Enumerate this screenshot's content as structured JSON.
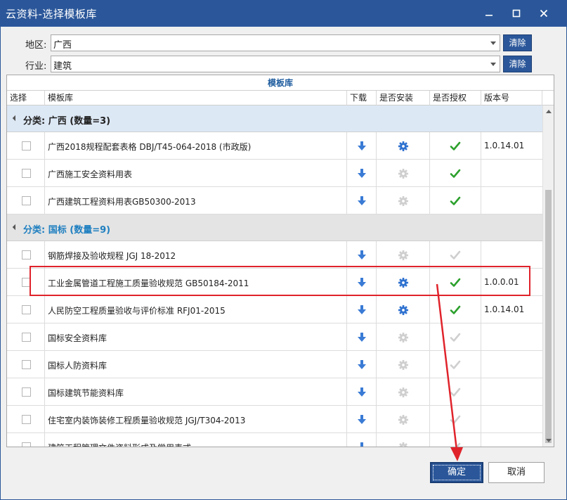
{
  "window": {
    "title": "云资料-选择模板库",
    "controls": [
      "minimize",
      "maximize",
      "close"
    ]
  },
  "filters": {
    "region_label": "地区:",
    "region_value": "广西",
    "industry_label": "行业:",
    "industry_value": "建筑",
    "clear_label": "清除"
  },
  "grid": {
    "caption": "模板库",
    "columns": {
      "select": "选择",
      "name": "模板库",
      "download": "下载",
      "installed": "是否安装",
      "authorized": "是否授权",
      "version": "版本号"
    },
    "groups": [
      {
        "label": "分类: 广西 (数量=3)",
        "rows": [
          {
            "name": "广西2018规程配套表格 DBJ/T45-064-2018 (市政版)",
            "installed": true,
            "authorized": true,
            "version": "1.0.14.01"
          },
          {
            "name": "广西施工安全资料用表",
            "installed": false,
            "authorized": true,
            "version": ""
          },
          {
            "name": "广西建筑工程资料用表GB50300-2013",
            "installed": false,
            "authorized": true,
            "version": ""
          }
        ]
      },
      {
        "label": "分类: 国标 (数量=9)",
        "rows": [
          {
            "name": "钢筋焊接及验收规程 JGJ 18-2012",
            "installed": false,
            "authorized": false,
            "version": ""
          },
          {
            "name": "工业金属管道工程施工质量验收规范 GB50184-2011",
            "installed": true,
            "authorized": true,
            "version": "1.0.0.01"
          },
          {
            "name": "人民防空工程质量验收与评价标准 RFJ01-2015",
            "installed": true,
            "authorized": true,
            "version": "1.0.14.01"
          },
          {
            "name": "国标安全资料库",
            "installed": false,
            "authorized": false,
            "version": ""
          },
          {
            "name": "国标人防资料库",
            "installed": false,
            "authorized": false,
            "version": ""
          },
          {
            "name": "国标建筑节能资料库",
            "installed": false,
            "authorized": false,
            "version": ""
          },
          {
            "name": "住宅室内装饰装修工程质量验收规范 JGJ/T304-2013",
            "installed": false,
            "authorized": false,
            "version": ""
          },
          {
            "name": "建筑工程管理文件资料形成及常用表式",
            "installed": false,
            "authorized": false,
            "version": ""
          }
        ]
      }
    ]
  },
  "buttons": {
    "ok": "确定",
    "cancel": "取消"
  },
  "colors": {
    "titlebar": "#2b579a",
    "accent_blue": "#3a7bd5",
    "check_green": "#2ca02c",
    "highlight_red": "#e0232b"
  },
  "icons": {
    "download": "download-arrow-icon",
    "installed": "gear-icon",
    "authorized": "checkmark-icon"
  }
}
